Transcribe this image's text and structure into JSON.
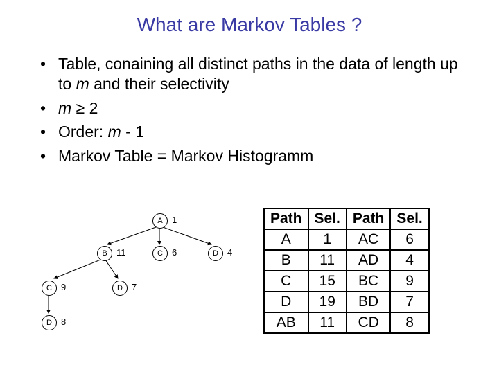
{
  "title": "What are Markov Tables ?",
  "bullets": {
    "b1a": "Table, conaining all distinct paths in the data of length up to ",
    "b1m": "m",
    "b1b": " and their selectivity",
    "b2m": "m",
    "b2ge": " ≥ ",
    "b2v": "2",
    "b3a": "Order: ",
    "b3m": "m",
    "b3b": " - 1",
    "b4": "Markov Table = Markov Histogramm"
  },
  "tree": {
    "A": {
      "label": "A",
      "count": "1"
    },
    "B": {
      "label": "B",
      "count": "11"
    },
    "C1": {
      "label": "C",
      "count": "6"
    },
    "D1": {
      "label": "D",
      "count": "4"
    },
    "C2": {
      "label": "C",
      "count": "9"
    },
    "D2": {
      "label": "D",
      "count": "7"
    },
    "D3": {
      "label": "D",
      "count": "8"
    }
  },
  "table": {
    "h1": "Path",
    "h2": "Sel.",
    "h3": "Path",
    "h4": "Sel.",
    "rows": [
      {
        "p1": "A",
        "s1": "1",
        "p2": "AC",
        "s2": "6"
      },
      {
        "p1": "B",
        "s1": "11",
        "p2": "AD",
        "s2": "4"
      },
      {
        "p1": "C",
        "s1": "15",
        "p2": "BC",
        "s2": "9"
      },
      {
        "p1": "D",
        "s1": "19",
        "p2": "BD",
        "s2": "7"
      },
      {
        "p1": "AB",
        "s1": "11",
        "p2": "CD",
        "s2": "8"
      }
    ]
  }
}
